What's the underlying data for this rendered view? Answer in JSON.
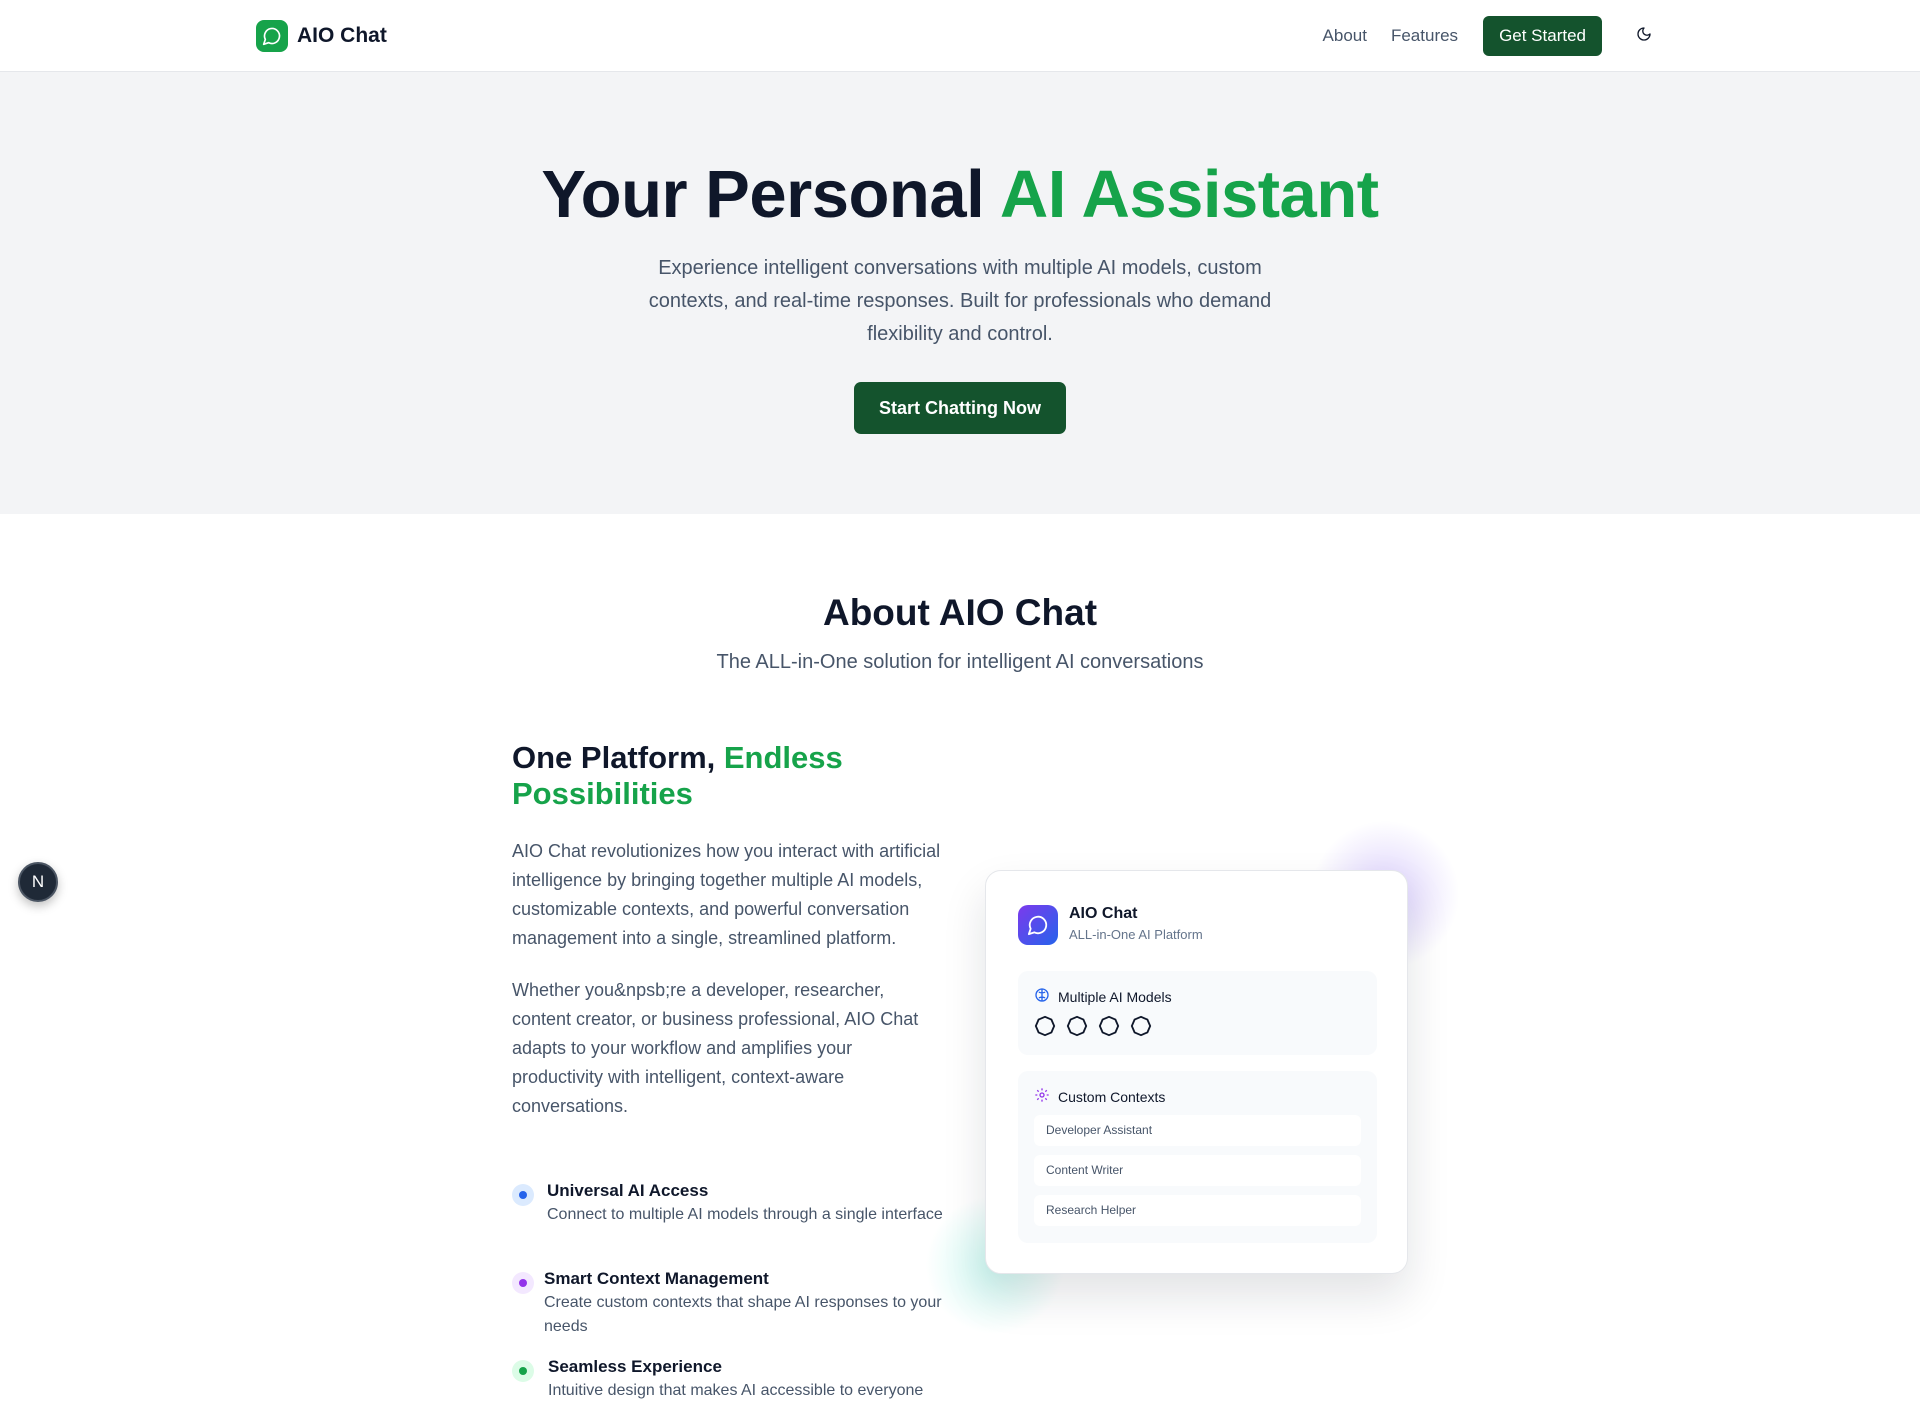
{
  "header": {
    "brand": "AIO Chat",
    "nav": [
      {
        "label": "About"
      },
      {
        "label": "Features"
      }
    ],
    "cta": "Get Started",
    "theme_icon": "moon-icon"
  },
  "hero": {
    "title_lead": "Your Personal ",
    "title_accent": "AI Assistant",
    "subtitle": "Experience intelligent conversations with multiple AI models, custom contexts, and real-time responses. Built for professionals who demand flexibility and control.",
    "button": "Start Chatting Now"
  },
  "about": {
    "title": "About AIO Chat",
    "subtitle": "The ALL-in-One solution for intelligent AI conversations",
    "heading_lead": "One Platform, ",
    "heading_accent": "Endless Possibilities",
    "paragraphs": [
      "AIO Chat revolutionizes how you interact with artificial intelligence by bringing together multiple AI models, customizable contexts, and powerful conversation management into a single, streamlined platform.",
      "Whether you&npsb;re a developer, researcher, content creator, or business professional, AIO Chat adapts to your workflow and amplifies your productivity with intelligent, context-aware conversations."
    ],
    "features": [
      {
        "title": "Universal AI Access",
        "desc": "Connect to multiple AI models through a single interface",
        "color": "#2563eb",
        "bg": "#dbeafe"
      },
      {
        "title": "Smart Context Management",
        "desc": "Create custom contexts that shape AI responses to your needs",
        "color": "#9333ea",
        "bg": "#f3e8ff"
      },
      {
        "title": "Seamless Experience",
        "desc": "Intuitive design that makes AI accessible to everyone",
        "color": "#16a34a",
        "bg": "#dcfce7"
      }
    ]
  },
  "card": {
    "name": "AIO Chat",
    "tagline": "ALL-in-One AI Platform",
    "models_label": "Multiple AI Models",
    "model_icons": [
      "model-icon",
      "model-icon",
      "model-icon",
      "model-icon"
    ],
    "contexts_label": "Custom Contexts",
    "contexts": [
      "Developer Assistant",
      "Content Writer",
      "Research Helper"
    ]
  },
  "badge": "N",
  "colors": {
    "accent": "#16a34a",
    "primary_button": "#14532d",
    "hero_bg": "#f3f4f6",
    "text_dark": "#0f172a",
    "text_muted": "#475569"
  }
}
